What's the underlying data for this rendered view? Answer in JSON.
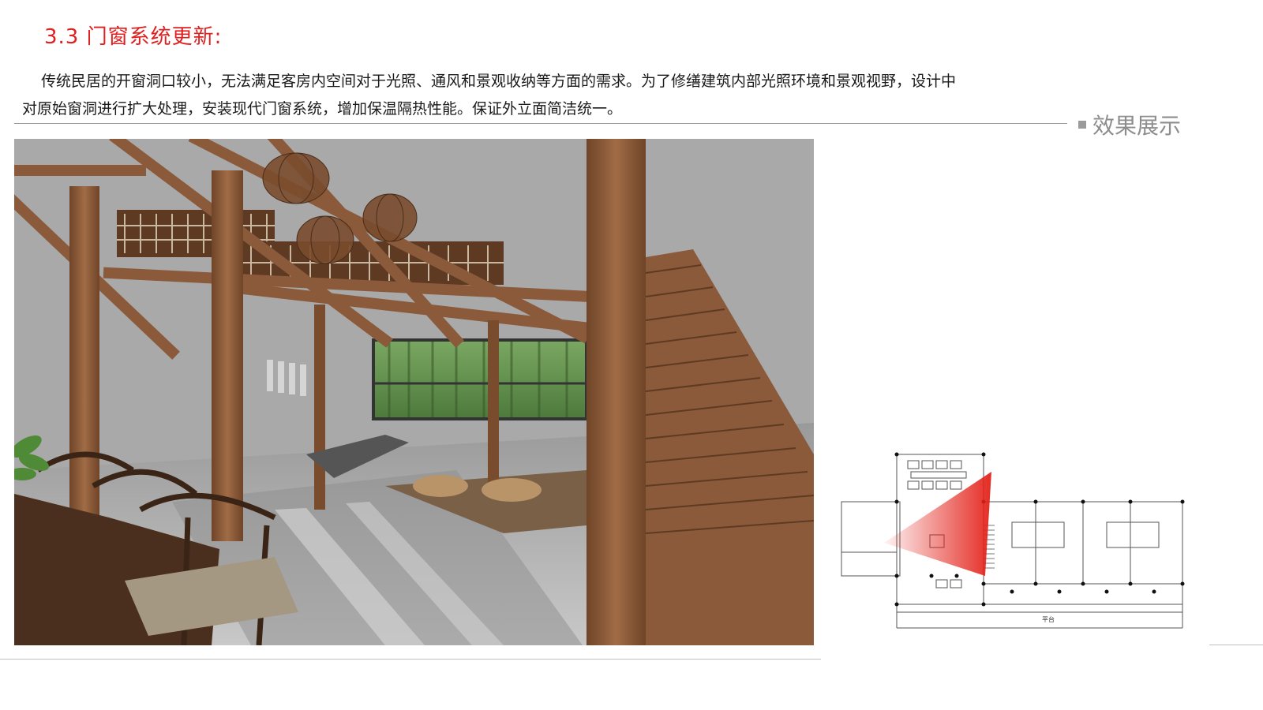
{
  "header": {
    "section_title": "3.3  门窗系统更新:"
  },
  "intro": {
    "text": "传统民居的开窗洞口较小，无法满足客房内空间对于光照、通风和景观收纳等方面的需求。为了修缮建筑内部光照环境和景观视野，设计中对原始窗洞进行扩大处理，安装现代门窗系统，增加保温隔热性能。保证外立面简洁统一。"
  },
  "showcase": {
    "label": "效果展示"
  },
  "floor_plan": {
    "platform_label": "平台"
  },
  "colors": {
    "title_red": "#e02020",
    "wood": "#8a5a3a",
    "bamboo_green": "#5f8f4e",
    "view_cone_red": "#e32018"
  }
}
